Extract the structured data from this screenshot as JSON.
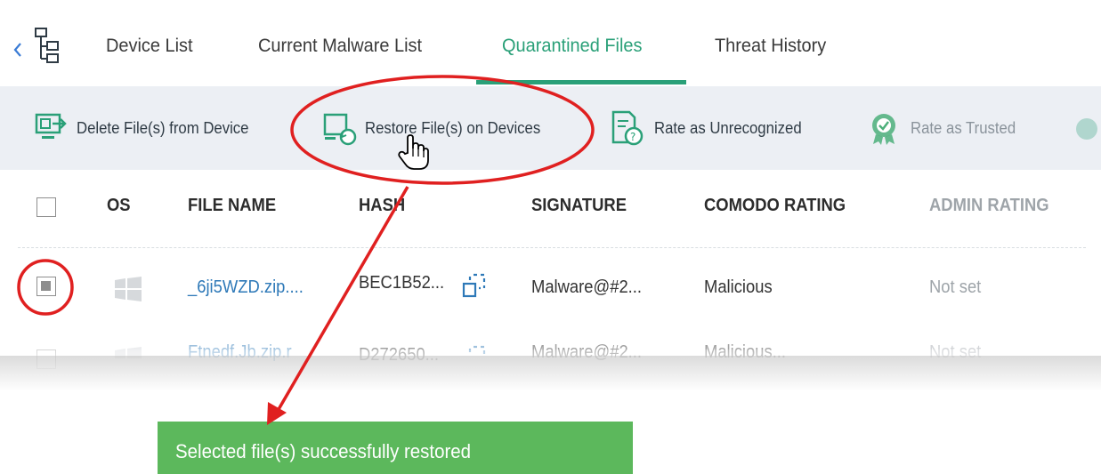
{
  "tabs": {
    "items": [
      {
        "label": "Device List"
      },
      {
        "label": "Current Malware List"
      },
      {
        "label": "Quarantined Files"
      },
      {
        "label": "Threat History"
      }
    ],
    "active": "Quarantined Files"
  },
  "toolbar": {
    "delete_label": "Delete File(s) from Device",
    "restore_label": "Restore File(s) on Devices",
    "rate_unrecognized_label": "Rate as Unrecognized",
    "rate_trusted_label": "Rate as Trusted"
  },
  "table": {
    "headers": {
      "os": "OS",
      "file_name": "FILE NAME",
      "hash": "HASH",
      "signature": "SIGNATURE",
      "comodo_rating": "COMODO RATING",
      "admin_rating": "ADMIN RATING"
    },
    "rows": [
      {
        "file_name": "_6ji5WZD.zip....",
        "hash": "BEC1B52...",
        "signature": "Malware@#2...",
        "comodo_rating": "Malicious",
        "admin_rating": "Not set",
        "selected": true
      },
      {
        "file_name": "Ftnedf.Jb.zip.r",
        "hash": "D272650...",
        "signature": "Malware@#2...",
        "comodo_rating": "Malicious...",
        "admin_rating": "Not set",
        "selected": false
      }
    ]
  },
  "toast": {
    "message": "Selected file(s) successfully restored"
  },
  "colors": {
    "accent": "#2aa078",
    "link": "#2e79b8",
    "toast_bg": "#5cb85c",
    "annotation": "#e02020",
    "toolbar_bg": "#eceff4"
  },
  "icons": [
    "back-chevron-icon",
    "tree-hierarchy-icon",
    "delete-from-device-icon",
    "restore-on-devices-icon",
    "rate-unrecognized-icon",
    "rate-trusted-icon",
    "windows-os-icon",
    "copy-hash-icon",
    "hand-cursor-icon"
  ]
}
